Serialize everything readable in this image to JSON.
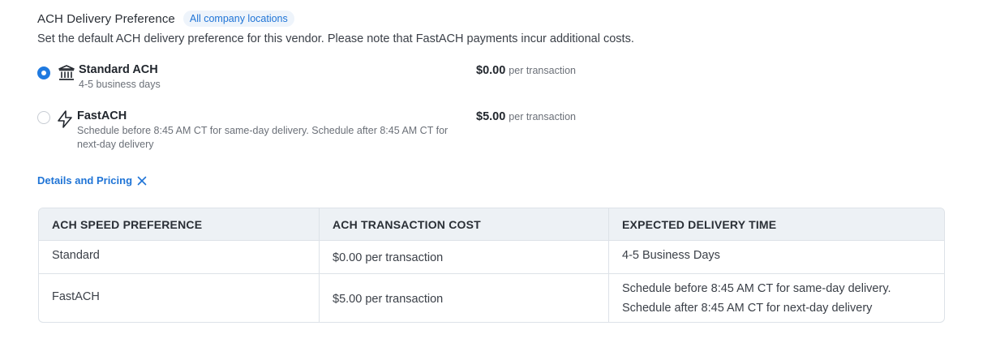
{
  "section": {
    "title": "ACH Delivery Preference",
    "badge": "All company locations",
    "subtitle": "Set the default ACH delivery preference for this vendor. Please note that FastACH payments incur additional costs."
  },
  "options": [
    {
      "name": "Standard ACH",
      "description": "4-5 business days",
      "price": "$0.00",
      "price_unit": "per transaction",
      "selected": true,
      "icon": "bank-icon"
    },
    {
      "name": "FastACH",
      "description": "Schedule before 8:45 AM CT for same-day delivery. Schedule after 8:45 AM CT for next-day delivery",
      "price": "$5.00",
      "price_unit": "per transaction",
      "selected": false,
      "icon": "lightning-icon"
    }
  ],
  "details_link": {
    "label": "Details and Pricing",
    "icon": "close-icon"
  },
  "table": {
    "headers": [
      "ACH SPEED PREFERENCE",
      "ACH TRANSACTION COST",
      "EXPECTED DELIVERY TIME"
    ],
    "rows": [
      {
        "speed": "Standard",
        "cost": "$0.00 per transaction",
        "delivery": [
          "4-5 Business Days"
        ]
      },
      {
        "speed": "FastACH",
        "cost": "$5.00 per transaction",
        "delivery": [
          "Schedule before 8:45 AM CT for same-day delivery.",
          "Schedule after 8:45 AM CT for next-day delivery"
        ]
      }
    ]
  },
  "colors": {
    "accent": "#1f7ae0",
    "link": "#1f74d6",
    "table_header_bg": "#edf1f5",
    "border": "#dde2e8"
  }
}
